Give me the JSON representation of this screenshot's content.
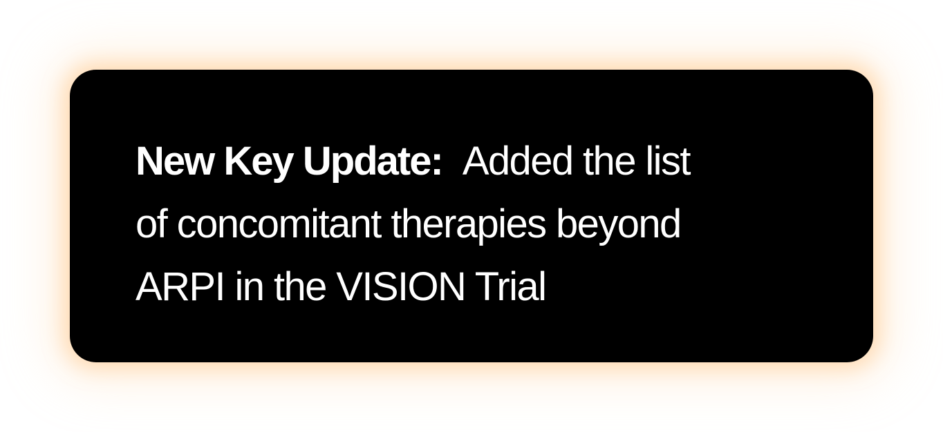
{
  "callout": {
    "lead": "New Key Update:",
    "line1": "Added the list",
    "line2": "of concomitant therapies beyond",
    "line3": "ARPI in the VISION Trial",
    "colors": {
      "background": "#000000",
      "text": "#ffffff",
      "glow": "#ffd7a8"
    }
  }
}
